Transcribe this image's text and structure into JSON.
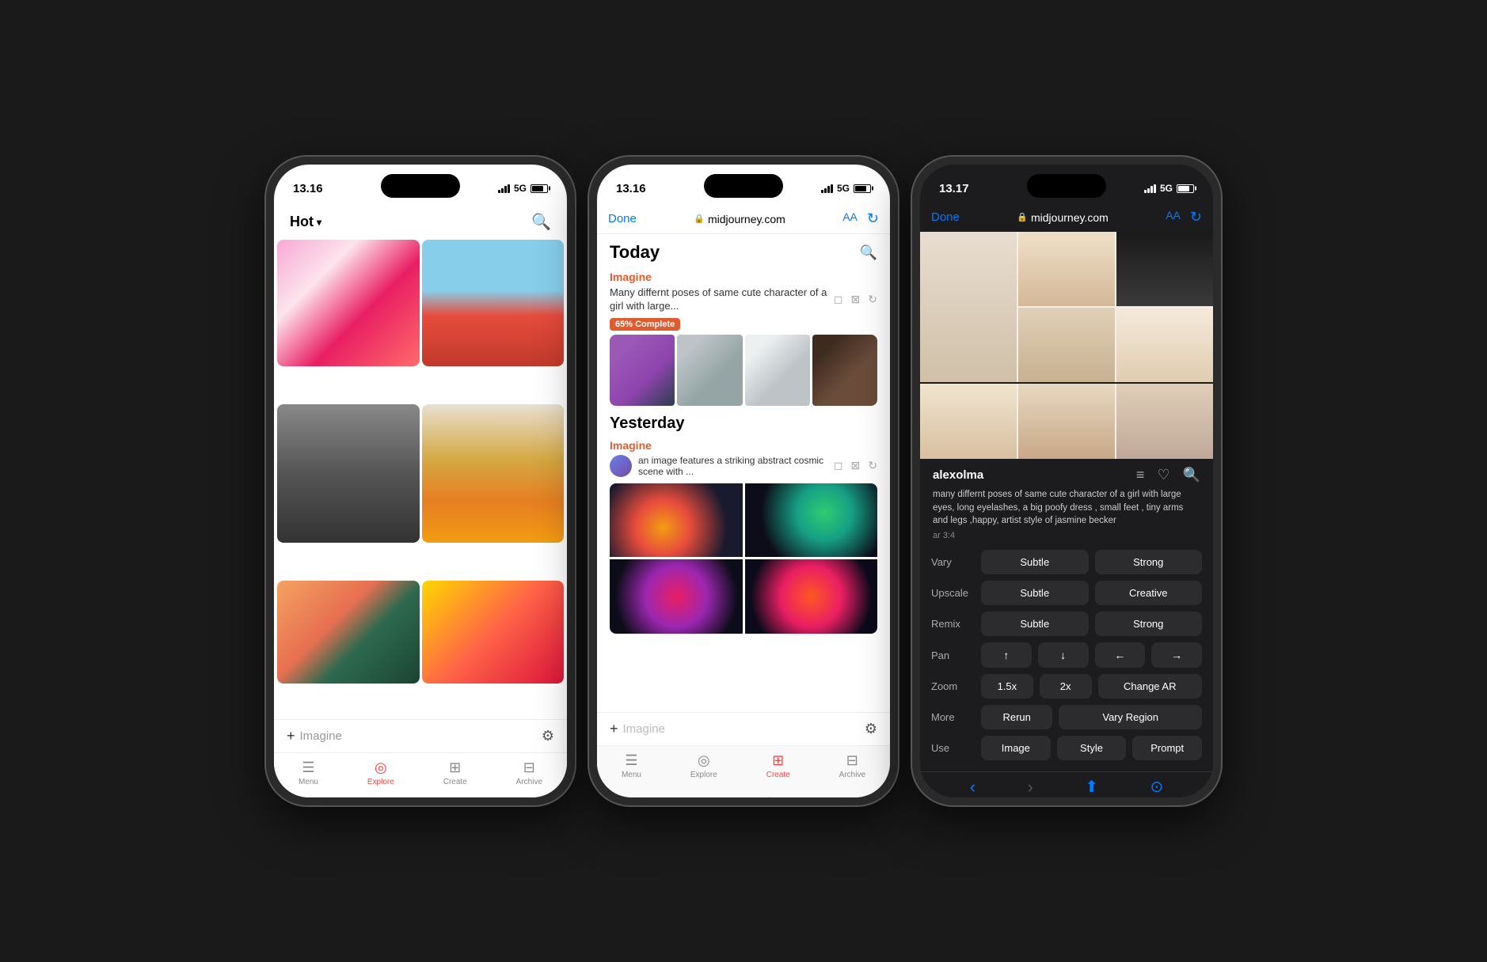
{
  "phone1": {
    "status": {
      "time": "13.16",
      "signal": "5G"
    },
    "header": {
      "filter": "Hot",
      "filter_arrow": "∨"
    },
    "imagine_bar": {
      "plus": "+",
      "label": "Imagine",
      "filter_icon": "⚙"
    },
    "tabs": [
      {
        "id": "menu",
        "label": "Menu",
        "icon": "☰",
        "active": false
      },
      {
        "id": "explore",
        "label": "Explore",
        "icon": "◎",
        "active": true
      },
      {
        "id": "create",
        "label": "Create",
        "icon": "⊞",
        "active": false
      },
      {
        "id": "archive",
        "label": "Archive",
        "icon": "⊟",
        "active": false
      }
    ]
  },
  "phone2": {
    "status": {
      "time": "13.16",
      "signal": "5G"
    },
    "browser": {
      "done": "Done",
      "url": "midjourney.com",
      "aa": "AA",
      "refresh": "↻"
    },
    "today_section": "Today",
    "imagine_label": "Imagine",
    "prompt_text": "Many differnt poses of same cute character of a girl with large...",
    "progress": "65% Complete",
    "yesterday_section": "Yesterday",
    "imagine_label2": "Imagine",
    "prompt_text2": "an image features a striking abstract cosmic scene with ...",
    "imagine_placeholder": "Imagine",
    "tabs": [
      {
        "id": "menu",
        "label": "Menu",
        "icon": "☰",
        "active": false
      },
      {
        "id": "explore",
        "label": "Explore",
        "icon": "◎",
        "active": false
      },
      {
        "id": "create",
        "label": "Create",
        "icon": "⊞",
        "active": true
      },
      {
        "id": "archive",
        "label": "Archive",
        "icon": "⊟",
        "active": false
      }
    ]
  },
  "phone3": {
    "status": {
      "time": "13.17",
      "signal": "5G"
    },
    "browser": {
      "done": "Done",
      "url": "midjourney.com",
      "aa": "AA",
      "refresh": "↻"
    },
    "username": "alexolma",
    "prompt": "many differnt poses of same cute character of a girl with large eyes, long eyelashes, a big poofy dress , small feet , tiny arms and legs ,happy, artist style of jasmine becker",
    "ar": "ar 3:4",
    "actions": {
      "vary": {
        "label": "Vary",
        "subtle": "Subtle",
        "strong": "Strong"
      },
      "upscale": {
        "label": "Upscale",
        "subtle": "Subtle",
        "creative": "Creative"
      },
      "remix": {
        "label": "Remix",
        "subtle": "Subtle",
        "strong": "Strong"
      },
      "pan": {
        "label": "Pan",
        "up": "↑",
        "down": "↓",
        "left": "←",
        "right": "→"
      },
      "zoom": {
        "label": "Zoom",
        "x15": "1.5x",
        "x2": "2x",
        "change_ar": "Change AR"
      },
      "more": {
        "label": "More",
        "rerun": "Rerun",
        "vary_region": "Vary Region"
      },
      "use": {
        "label": "Use",
        "image": "Image",
        "style": "Style",
        "prompt": "Prompt"
      }
    }
  }
}
